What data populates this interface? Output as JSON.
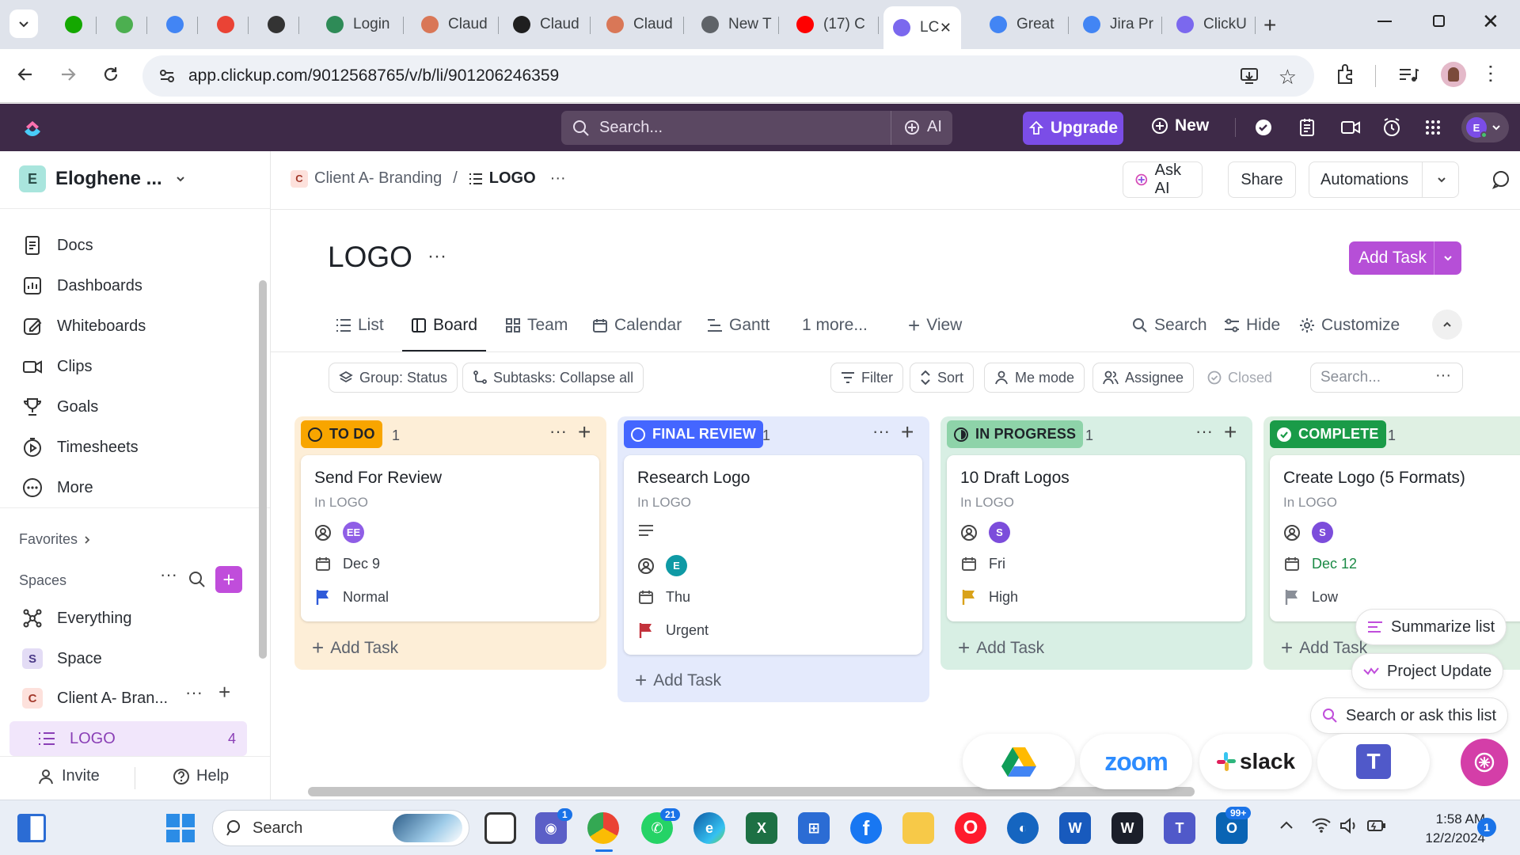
{
  "browser": {
    "tabs": [
      {
        "label": "",
        "icon": "upwork-icon",
        "color": "#14a800"
      },
      {
        "label": "",
        "icon": "pen-icon",
        "color": "#4caf50"
      },
      {
        "label": "",
        "icon": "google-icon",
        "color": "#4285f4"
      },
      {
        "label": "",
        "icon": "gmail-icon",
        "color": "#ea4335"
      },
      {
        "label": "",
        "icon": "openai-icon",
        "color": "#333333"
      },
      {
        "label": "Login",
        "icon": "login-icon",
        "color": "#2e8b57"
      },
      {
        "label": "Claud",
        "icon": "claude-icon",
        "color": "#d97757"
      },
      {
        "label": "Claud",
        "icon": "anthropic-icon",
        "color": "#1f1f1f"
      },
      {
        "label": "Claud",
        "icon": "claude-icon",
        "color": "#d97757"
      },
      {
        "label": "New T",
        "icon": "chrome-icon",
        "color": "#5f6368"
      },
      {
        "label": "(17) C",
        "icon": "youtube-icon",
        "color": "#ff0000"
      },
      {
        "label": "LC",
        "icon": "clickup-icon",
        "color": "#7b68ee"
      },
      {
        "label": "Great",
        "icon": "google-icon",
        "color": "#4285f4"
      },
      {
        "label": "Jira Pr",
        "icon": "google-icon",
        "color": "#4285f4"
      },
      {
        "label": "ClickU",
        "icon": "clickup-u-icon",
        "color": "#7b68ee"
      }
    ],
    "url": "app.clickup.com/9012568765/v/b/li/901206246359"
  },
  "topbar": {
    "search_placeholder": "Search...",
    "ai_label": "AI",
    "upgrade_label": "Upgrade",
    "new_label": "New",
    "user_initial": "E"
  },
  "sidebar": {
    "workspace_initial": "E",
    "workspace_name": "Eloghene ...",
    "nav": [
      {
        "label": "Docs",
        "icon": "docs-icon"
      },
      {
        "label": "Dashboards",
        "icon": "dashboards-icon"
      },
      {
        "label": "Whiteboards",
        "icon": "whiteboards-icon"
      },
      {
        "label": "Clips",
        "icon": "clips-icon"
      },
      {
        "label": "Goals",
        "icon": "goals-icon"
      },
      {
        "label": "Timesheets",
        "icon": "timesheets-icon"
      },
      {
        "label": "More",
        "icon": "more-icon"
      }
    ],
    "favorites_label": "Favorites",
    "spaces_label": "Spaces",
    "spaces": [
      {
        "label": "Everything",
        "icon": "everything-icon"
      },
      {
        "label": "Space",
        "initial": "S"
      },
      {
        "label": "Client A- Bran...",
        "initial": "C"
      }
    ],
    "active_list": {
      "label": "LOGO",
      "count": "4"
    },
    "invite_label": "Invite",
    "help_label": "Help"
  },
  "header": {
    "breadcrumb_space_initial": "C",
    "breadcrumb_space": "Client A- Branding",
    "breadcrumb_sep": "/",
    "breadcrumb_list": "LOGO",
    "ask_ai_label": "Ask AI",
    "share_label": "Share",
    "automations_label": "Automations"
  },
  "page": {
    "title": "LOGO",
    "add_task_label": "Add Task",
    "views": [
      "List",
      "Board",
      "Team",
      "Calendar",
      "Gantt",
      "1 more...",
      "View"
    ],
    "active_view": "Board",
    "view_tools": [
      "Search",
      "Hide",
      "Customize"
    ],
    "filters_left": [
      "Group: Status",
      "Subtasks: Collapse all"
    ],
    "filters_right": [
      "Filter",
      "Sort",
      "Me mode",
      "Assignee",
      "Closed"
    ],
    "filter_search_placeholder": "Search..."
  },
  "board": {
    "add_task_label": "Add Task",
    "columns": [
      {
        "status": "TO DO",
        "count": "1",
        "color": "#f8a500",
        "bg": "#fdeed7",
        "card": {
          "title": "Send For Review",
          "location": "In LOGO",
          "assignee": "EE",
          "assignee_color": "#8f5ee6",
          "date": "Dec 9",
          "date_color": "#3a3f47",
          "priority": "Normal",
          "priority_color": "#2f5bd9",
          "has_desc": false
        }
      },
      {
        "status": "FINAL REVIEW",
        "count": "1",
        "color": "#4466ff",
        "bg": "#e4eafc",
        "card": {
          "title": "Research Logo",
          "location": "In LOGO",
          "assignee": "E",
          "assignee_color": "#0f9aa5",
          "date": "Thu",
          "date_color": "#3a3f47",
          "priority": "Urgent",
          "priority_color": "#c3323c",
          "has_desc": true
        }
      },
      {
        "status": "IN PROGRESS",
        "count": "1",
        "color": "#31a066",
        "bg": "#d8efe4",
        "card": {
          "title": "10 Draft Logos",
          "location": "In LOGO",
          "assignee": "S",
          "assignee_color": "#7c4ddb",
          "date": "Fri",
          "date_color": "#3a3f47",
          "priority": "High",
          "priority_color": "#d9a21a",
          "has_desc": false
        }
      },
      {
        "status": "COMPLETE",
        "count": "1",
        "color": "#1a9b48",
        "bg": "#dff0e3",
        "card": {
          "title": "Create Logo (5 Formats)",
          "location": "In LOGO",
          "assignee": "S",
          "assignee_color": "#7c4ddb",
          "date": "Dec 12",
          "date_color": "#1a8a45",
          "priority": "Low",
          "priority_color": "#8a8f98",
          "has_desc": false
        }
      }
    ]
  },
  "floating": {
    "summarize_label": "Summarize list",
    "update_label": "Project Update",
    "search_ask_label": "Search or ask this list",
    "apps": [
      "google-drive-icon",
      "zoom",
      "slack",
      "teams-icon"
    ]
  },
  "taskbar": {
    "search_label": "Search",
    "time": "1:58 AM",
    "date": "12/2/2024",
    "notification_count": "1",
    "badges": {
      "chat": "1",
      "whatsapp": "21",
      "outlook": "99+"
    }
  }
}
